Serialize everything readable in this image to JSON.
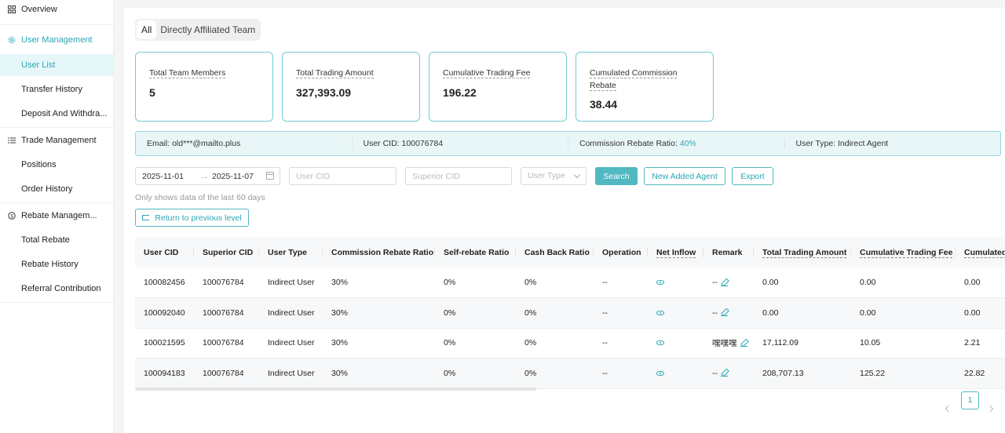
{
  "sidebar": {
    "overview": "Overview",
    "user_management": "User Management",
    "user_list": "User List",
    "transfer_history": "Transfer History",
    "deposit_withdraw": "Deposit And Withdra...",
    "trade_management": "Trade Management",
    "positions": "Positions",
    "order_history": "Order History",
    "rebate_management": "Rebate Managem...",
    "total_rebate": "Total Rebate",
    "rebate_history": "Rebate History",
    "referral_contribution": "Referral Contribution"
  },
  "tabs": {
    "all": "All",
    "direct": "Directly Affiliated Team"
  },
  "stats": [
    {
      "label": "Total Team Members",
      "value": "5"
    },
    {
      "label": "Total Trading Amount",
      "value": "327,393.09"
    },
    {
      "label": "Cumulative Trading Fee",
      "value": "196.22"
    },
    {
      "label": "Cumulated Commission Rebate",
      "value": "38.44"
    }
  ],
  "info": {
    "email": "Email: old***@mailto.plus",
    "user_cid": "User CID: 100076784",
    "ratio_label": "Commission Rebate Ratio: ",
    "ratio_value": "40%",
    "user_type": "User Type: Indirect Agent"
  },
  "filters": {
    "date_from": "2025-11-01",
    "date_to": "2025-11-07",
    "range_arrow": "→",
    "user_cid_placeholder": "User CID",
    "superior_cid_placeholder": "Superior CID",
    "user_type_placeholder": "User Type",
    "search": "Search",
    "new_agent": "New Added Agent",
    "export": "Export",
    "hint": "Only shows data of the last 60 days",
    "return": "Return to previous level"
  },
  "table": {
    "headers": [
      "User CID",
      "Superior CID",
      "User Type",
      "Commission Rebate Ratio",
      "Self-rebate Ratio",
      "Cash Back Ratio",
      "Operation",
      "Net Inflow",
      "Remark",
      "Total Trading Amount",
      "Cumulative Trading Fee",
      "Cumulated"
    ],
    "rows": [
      {
        "cid": "100082456",
        "superior": "100076784",
        "type": "Indirect User",
        "commission": "30%",
        "self": "0%",
        "cashback": "0%",
        "operation": "--",
        "remark": "--",
        "amount": "0.00",
        "fee": "0.00",
        "cumulated": "0.00"
      },
      {
        "cid": "100092040",
        "superior": "100076784",
        "type": "Indirect User",
        "commission": "30%",
        "self": "0%",
        "cashback": "0%",
        "operation": "--",
        "remark": "--",
        "amount": "0.00",
        "fee": "0.00",
        "cumulated": "0.00"
      },
      {
        "cid": "100021595",
        "superior": "100076784",
        "type": "Indirect User",
        "commission": "30%",
        "self": "0%",
        "cashback": "0%",
        "operation": "--",
        "remark": "嘿嘿嘿",
        "amount": "17,112.09",
        "fee": "10.05",
        "cumulated": "2.21"
      },
      {
        "cid": "100094183",
        "superior": "100076784",
        "type": "Indirect User",
        "commission": "30%",
        "self": "0%",
        "cashback": "0%",
        "operation": "--",
        "remark": "--",
        "amount": "208,707.13",
        "fee": "125.22",
        "cumulated": "22.82"
      }
    ]
  },
  "pagination": {
    "current": "1"
  },
  "colors": {
    "accent": "#2aa7b5",
    "accent_light": "#e6f7f9",
    "border": "#74cbd3"
  }
}
